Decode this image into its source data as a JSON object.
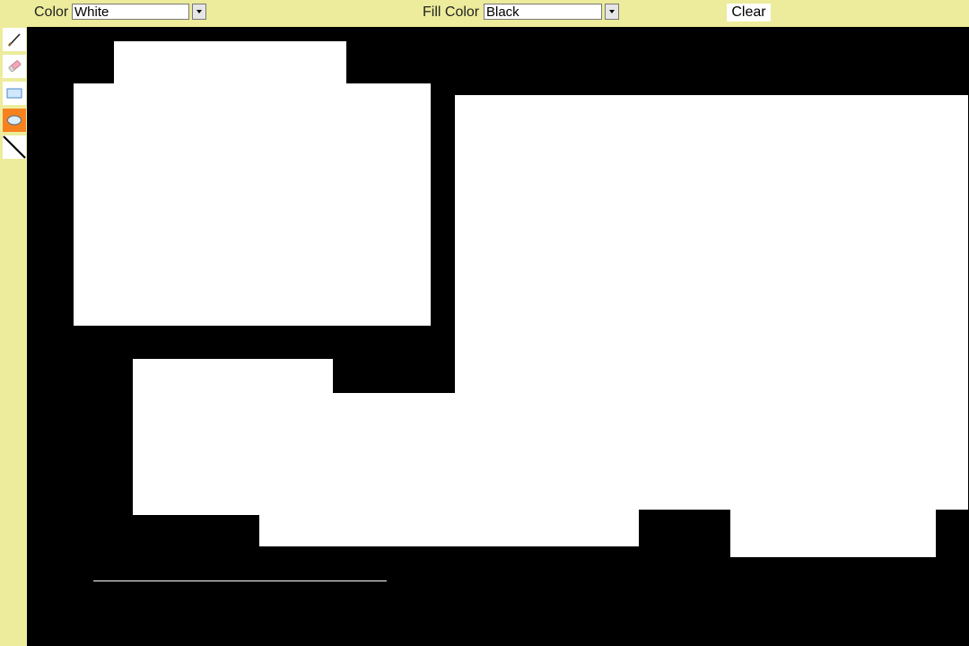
{
  "toolbar": {
    "color_label": "Color",
    "color_value": "White",
    "fill_label": "Fill Color",
    "fill_value": "Black",
    "clear_label": "Clear"
  },
  "tools": [
    {
      "name": "brush",
      "icon": "brush-icon",
      "active": false
    },
    {
      "name": "eraser",
      "icon": "eraser-icon",
      "active": false
    },
    {
      "name": "rectangle",
      "icon": "rectangle-icon",
      "active": false
    },
    {
      "name": "ellipse",
      "icon": "ellipse-icon",
      "active": true
    },
    {
      "name": "line",
      "icon": "line-icon",
      "active": false
    }
  ],
  "canvas": {
    "background": "#000000",
    "stroke_color": "#ffffff",
    "fill_color": "#000000"
  },
  "colors": {
    "toolbar_bg": "#ecec9c",
    "active_tool": "#f5821f"
  }
}
